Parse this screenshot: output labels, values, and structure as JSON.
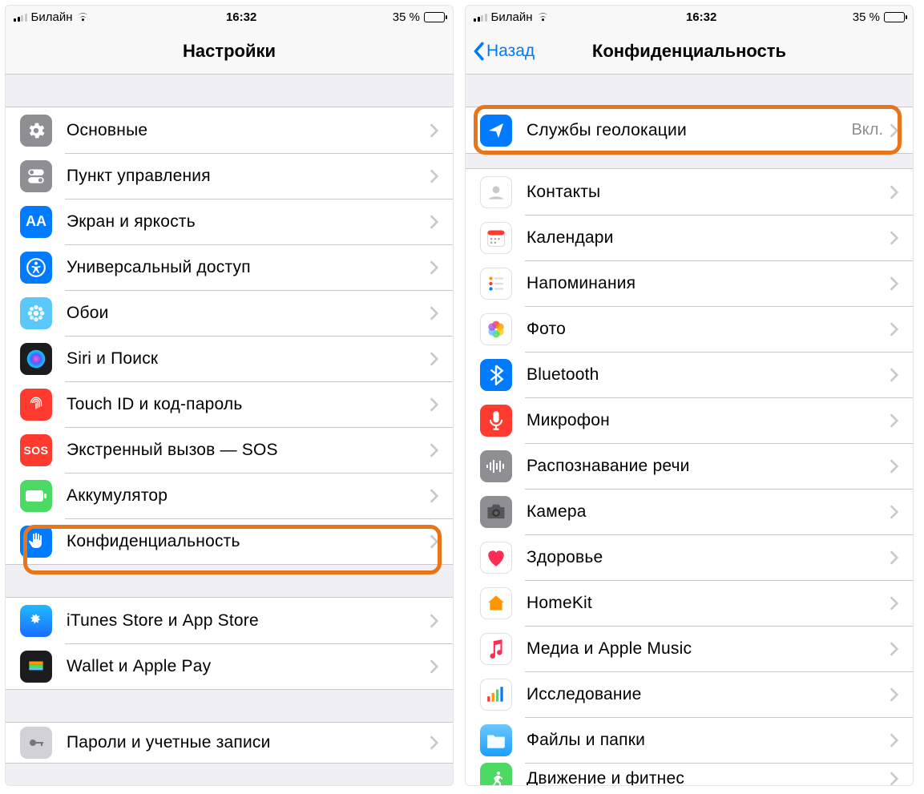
{
  "status": {
    "carrier": "Билайн",
    "time": "16:32",
    "battery_text": "35 %"
  },
  "left_screen": {
    "title": "Настройки",
    "groups": [
      {
        "rows": [
          {
            "id": "general",
            "label": "Основные"
          },
          {
            "id": "control",
            "label": "Пункт управления"
          },
          {
            "id": "display",
            "label": "Экран и яркость"
          },
          {
            "id": "accessibility",
            "label": "Универсальный доступ"
          },
          {
            "id": "wallpaper",
            "label": "Обои"
          },
          {
            "id": "siri",
            "label": "Siri и Поиск"
          },
          {
            "id": "touchid",
            "label": "Touch ID и код-пароль"
          },
          {
            "id": "sos",
            "label": "Экстренный вызов — SOS"
          },
          {
            "id": "battery",
            "label": "Аккумулятор"
          },
          {
            "id": "privacy",
            "label": "Конфиденциальность"
          }
        ]
      },
      {
        "rows": [
          {
            "id": "itunes",
            "label": "iTunes Store и App Store"
          },
          {
            "id": "wallet",
            "label": "Wallet и Apple Pay"
          }
        ]
      },
      {
        "rows": [
          {
            "id": "passwords",
            "label": "Пароли и учетные записи"
          }
        ]
      }
    ]
  },
  "right_screen": {
    "back": "Назад",
    "title": "Конфиденциальность",
    "groups": [
      {
        "rows": [
          {
            "id": "location",
            "label": "Службы геолокации",
            "value": "Вкл."
          }
        ]
      },
      {
        "rows": [
          {
            "id": "contacts",
            "label": "Контакты"
          },
          {
            "id": "calendars",
            "label": "Календари"
          },
          {
            "id": "reminders",
            "label": "Напоминания"
          },
          {
            "id": "photos",
            "label": "Фото"
          },
          {
            "id": "bluetooth",
            "label": "Bluetooth"
          },
          {
            "id": "microphone",
            "label": "Микрофон"
          },
          {
            "id": "speech",
            "label": "Распознавание речи"
          },
          {
            "id": "camera",
            "label": "Камера"
          },
          {
            "id": "health",
            "label": "Здоровье"
          },
          {
            "id": "homekit",
            "label": "HomeKit"
          },
          {
            "id": "media",
            "label": "Медиа и Apple Music"
          },
          {
            "id": "research",
            "label": "Исследование"
          },
          {
            "id": "files",
            "label": "Файлы и папки"
          },
          {
            "id": "motion",
            "label": "Движение и фитнес"
          }
        ]
      }
    ]
  }
}
